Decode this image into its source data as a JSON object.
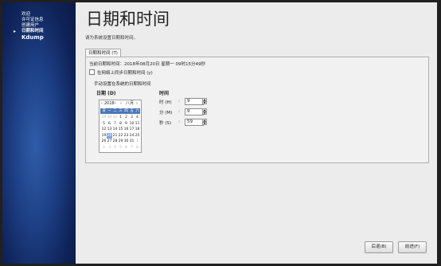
{
  "sidebar": {
    "items": [
      {
        "label": "欢迎"
      },
      {
        "label": "许可证信息"
      },
      {
        "label": "创建用户"
      },
      {
        "label": "日期和时间",
        "active": true
      },
      {
        "label": "Kdump"
      }
    ],
    "active_marker": "▸"
  },
  "page": {
    "title": "日期和时间",
    "instruction": "请为系统设置日期和时间。"
  },
  "tab": {
    "label": "日期和时间 (T)"
  },
  "panel": {
    "current_label": "当前日期和时间：",
    "current_value": "2018年08月20日 星期一 09时15分49秒",
    "sync_label": "在网络上同步日期和时间 (y)",
    "sync_checked": false,
    "manual_label": "手动设置在系统的日期和时间"
  },
  "date": {
    "heading": "日期 (D)",
    "year_prev": "‹",
    "year": "2018",
    "year_next": "›",
    "month_prev": "‹",
    "month": "八月",
    "month_next": "›",
    "weekdays": [
      "日",
      "一",
      "二",
      "三",
      "四",
      "五",
      "六"
    ],
    "weeks": [
      [
        {
          "d": "29",
          "dim": true
        },
        {
          "d": "30",
          "dim": true
        },
        {
          "d": "31",
          "dim": true
        },
        {
          "d": "1"
        },
        {
          "d": "2"
        },
        {
          "d": "3"
        },
        {
          "d": "4"
        }
      ],
      [
        {
          "d": "5"
        },
        {
          "d": "6"
        },
        {
          "d": "7"
        },
        {
          "d": "8"
        },
        {
          "d": "9"
        },
        {
          "d": "10"
        },
        {
          "d": "11"
        }
      ],
      [
        {
          "d": "12"
        },
        {
          "d": "13"
        },
        {
          "d": "14"
        },
        {
          "d": "15"
        },
        {
          "d": "16"
        },
        {
          "d": "17"
        },
        {
          "d": "18"
        }
      ],
      [
        {
          "d": "19"
        },
        {
          "d": "20",
          "sel": true
        },
        {
          "d": "21"
        },
        {
          "d": "22"
        },
        {
          "d": "23"
        },
        {
          "d": "24"
        },
        {
          "d": "25"
        }
      ],
      [
        {
          "d": "26"
        },
        {
          "d": "27"
        },
        {
          "d": "28"
        },
        {
          "d": "29"
        },
        {
          "d": "30"
        },
        {
          "d": "31"
        },
        {
          "d": "1",
          "dim": true
        }
      ],
      [
        {
          "d": "2",
          "dim": true
        },
        {
          "d": "3",
          "dim": true
        },
        {
          "d": "4",
          "dim": true
        },
        {
          "d": "5",
          "dim": true
        },
        {
          "d": "6",
          "dim": true
        },
        {
          "d": "7",
          "dim": true
        },
        {
          "d": "8",
          "dim": true
        }
      ]
    ]
  },
  "time": {
    "heading": "时间",
    "hour_label": "时 (H)",
    "hour_value": "9",
    "minute_label": "分 (M)",
    "minute_value": "9",
    "second_label": "秒 (S)",
    "second_value": "59",
    "colon": ":",
    "up": "▲",
    "down": "▼"
  },
  "buttons": {
    "back": "后退(B)",
    "forward": "前进(F)"
  },
  "colors": {
    "sidebar": "#1d3f85",
    "selection": "#4a78b8",
    "panel_bg": "#ececec"
  }
}
